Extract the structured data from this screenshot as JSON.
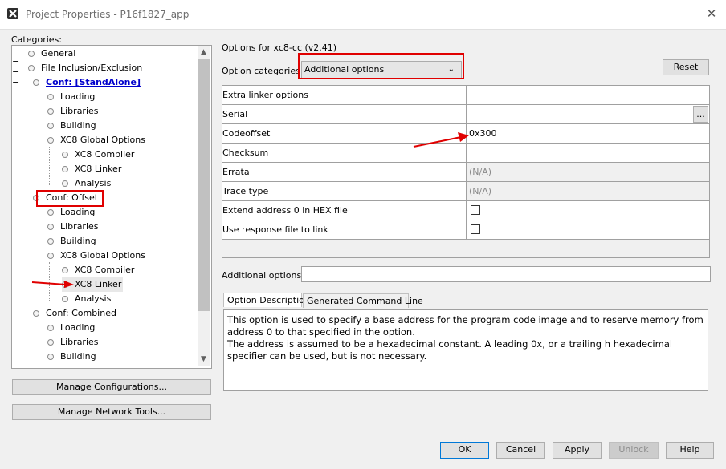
{
  "window": {
    "title": "Project Properties - P16f1827_app"
  },
  "categories_label": "Categories:",
  "tree": {
    "items": [
      {
        "label": "General"
      },
      {
        "label": "File Inclusion/Exclusion"
      },
      {
        "label": "Conf: [StandAlone]"
      },
      {
        "label": "Loading"
      },
      {
        "label": "Libraries"
      },
      {
        "label": "Building"
      },
      {
        "label": "XC8 Global Options"
      },
      {
        "label": "XC8 Compiler"
      },
      {
        "label": "XC8 Linker"
      },
      {
        "label": "Analysis"
      },
      {
        "label": "Conf: Offset"
      },
      {
        "label": "Loading"
      },
      {
        "label": "Libraries"
      },
      {
        "label": "Building"
      },
      {
        "label": "XC8 Global Options"
      },
      {
        "label": "XC8 Compiler"
      },
      {
        "label": "XC8 Linker"
      },
      {
        "label": "Analysis"
      },
      {
        "label": "Conf: Combined"
      },
      {
        "label": "Loading"
      },
      {
        "label": "Libraries"
      },
      {
        "label": "Building"
      }
    ]
  },
  "buttons": {
    "manage_configurations": "Manage Configurations...",
    "manage_network_tools": "Manage Network Tools...",
    "reset": "Reset",
    "ok": "OK",
    "cancel": "Cancel",
    "apply": "Apply",
    "unlock": "Unlock",
    "help": "Help",
    "browse": "..."
  },
  "options_header": "Options for xc8-cc (v2.41)",
  "option_categories": {
    "label": "Option categories:",
    "selected": "Additional options"
  },
  "grid": {
    "rows": [
      {
        "name": "Extra linker options",
        "value": ""
      },
      {
        "name": "Serial",
        "value": ""
      },
      {
        "name": "Codeoffset",
        "value": "0x300"
      },
      {
        "name": "Checksum",
        "value": ""
      },
      {
        "name": "Errata",
        "value": "(N/A)"
      },
      {
        "name": "Trace type",
        "value": "(N/A)"
      },
      {
        "name": "Extend address 0 in HEX file",
        "value": ""
      },
      {
        "name": "Use response file to link",
        "value": ""
      }
    ]
  },
  "additional_options": {
    "label": "Additional options:",
    "value": ""
  },
  "tabs": {
    "option_description": "Option Description",
    "generated_command_line": "Generated Command Line"
  },
  "description": {
    "line1": "This option is used to specify a base address for the program code image and to reserve memory from address 0 to that specified in the option.",
    "line2": "The address is assumed to be a hexadecimal constant. A leading 0x, or a trailing h hexadecimal specifier can be used, but is not necessary."
  },
  "colors": {
    "highlight_red": "#e00000",
    "link_blue": "#0000cc",
    "default_button_border": "#0078d7"
  },
  "icons": {
    "app": "mplab-x-icon",
    "close": "close-icon",
    "annotation": "red-arrow-icon"
  }
}
